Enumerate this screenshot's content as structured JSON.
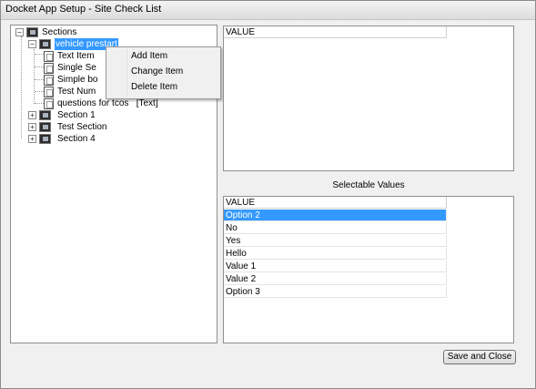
{
  "window": {
    "title": "Docket App Setup - Site Check List"
  },
  "tree": {
    "root": "Sections",
    "nodes": [
      {
        "label": "vehicle prestart"
      },
      {
        "label": "Text Item"
      },
      {
        "label": "Single Se"
      },
      {
        "label": "Simple bo"
      },
      {
        "label": "Test Num"
      },
      {
        "label": "questions for tcos   [Text]"
      },
      {
        "label": "Section 1"
      },
      {
        "label": "Test Section"
      },
      {
        "label": "Section 4"
      }
    ]
  },
  "context_menu": {
    "items": [
      "Add Item",
      "Change Item",
      "Delete Item"
    ]
  },
  "top_grid": {
    "header": "VALUE"
  },
  "selectable": {
    "caption": "Selectable Values",
    "header": "VALUE",
    "rows": [
      "Option 2",
      "No",
      "Yes",
      "Hello",
      "Value 1",
      "Value 2",
      "Option 3"
    ],
    "selected_index": 0
  },
  "buttons": {
    "save_close": "Save and Close"
  }
}
